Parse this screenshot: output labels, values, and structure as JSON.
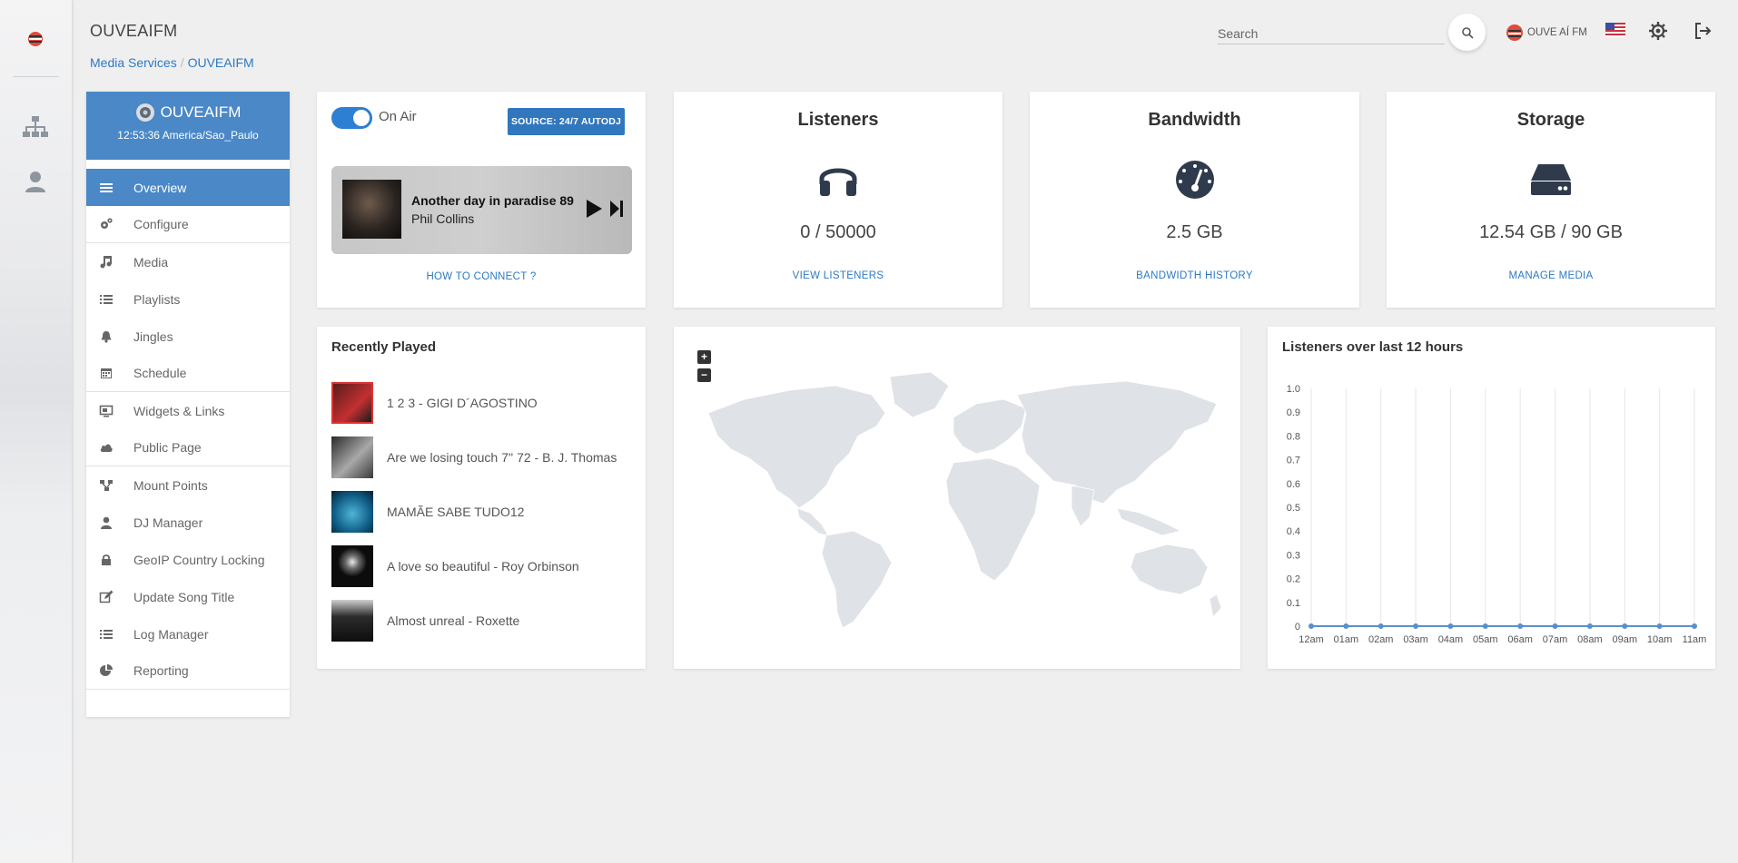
{
  "header": {
    "title": "OUVEAIFM",
    "breadcrumb": [
      "Media Services",
      "OUVEAIFM"
    ],
    "search_placeholder": "Search",
    "station_name": "OUVE AÍ FM",
    "icons": [
      "search-icon",
      "flag-us-icon",
      "theme-icon",
      "logout-icon"
    ]
  },
  "rail": {
    "icons": [
      "app-logo-icon",
      "sitemap-icon",
      "user-icon"
    ]
  },
  "sidebar": {
    "station": "OUVEAIFM",
    "time": "12:53:36 America/Sao_Paulo",
    "items": [
      {
        "label": "Overview",
        "icon": "list-icon",
        "active": true
      },
      {
        "label": "Configure",
        "icon": "cogs-icon"
      },
      {
        "label": "Media",
        "icon": "music-icon"
      },
      {
        "label": "Playlists",
        "icon": "list-icon"
      },
      {
        "label": "Jingles",
        "icon": "bell-icon"
      },
      {
        "label": "Schedule",
        "icon": "calendar-icon"
      },
      {
        "label": "Widgets & Links",
        "icon": "widget-icon"
      },
      {
        "label": "Public Page",
        "icon": "cloud-icon"
      },
      {
        "label": "Mount Points",
        "icon": "sitemap-icon"
      },
      {
        "label": "DJ Manager",
        "icon": "user-icon"
      },
      {
        "label": "GeoIP Country Locking",
        "icon": "lock-icon"
      },
      {
        "label": "Update Song Title",
        "icon": "edit-icon"
      },
      {
        "label": "Log Manager",
        "icon": "list-icon"
      },
      {
        "label": "Reporting",
        "icon": "pie-chart-icon"
      }
    ]
  },
  "onair": {
    "label": "On Air",
    "enabled": true,
    "source_label": "SOURCE: 24/7 AUTODJ",
    "song": "Another day in paradise 89",
    "artist": "Phil Collins",
    "link": "HOW TO CONNECT ?"
  },
  "stats": {
    "listeners": {
      "title": "Listeners",
      "value": "0 / 50000",
      "link": "VIEW LISTENERS",
      "icon": "headphones-icon"
    },
    "bandwidth": {
      "title": "Bandwidth",
      "value": "2.5 GB",
      "link": "BANDWIDTH HISTORY",
      "icon": "gauge-icon"
    },
    "storage": {
      "title": "Storage",
      "value": "12.54 GB / 90 GB",
      "link": "MANAGE MEDIA",
      "icon": "hdd-icon"
    }
  },
  "recent": {
    "title": "Recently Played",
    "items": [
      "1 2 3 - GIGI D´AGOSTINO",
      "Are we losing touch 7'' 72 - B. J. Thomas",
      "MAMÃE SABE TUDO12",
      "A love so beautiful - Roy Orbinson",
      "Almost unreal - Roxette"
    ]
  },
  "map": {
    "zoom_in": "+",
    "zoom_out": "−"
  },
  "chart_data": {
    "type": "line",
    "title": "Listeners over last 12 hours",
    "categories": [
      "12am",
      "01am",
      "02am",
      "03am",
      "04am",
      "05am",
      "06am",
      "07am",
      "08am",
      "09am",
      "10am",
      "11am"
    ],
    "values": [
      0,
      0,
      0,
      0,
      0,
      0,
      0,
      0,
      0,
      0,
      0,
      0
    ],
    "yticks": [
      "0",
      "0.1",
      "0.2",
      "0.3",
      "0.4",
      "0.5",
      "0.6",
      "0.7",
      "0.8",
      "0.9",
      "1.0"
    ],
    "ylim": [
      0,
      1
    ],
    "grid": "vertical",
    "color": "#5b8fc9"
  }
}
